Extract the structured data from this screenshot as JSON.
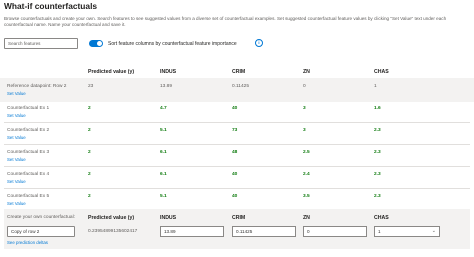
{
  "header": {
    "title": "What-if counterfactuals",
    "description": "Browse counterfactuals and create your own. Search features to see suggested values from a diverse set of counterfactual examples. Set suggested counterfactual feature values by clicking \"Set Value\" text under each counterfactual name. Name your counterfactual and save it."
  },
  "controls": {
    "search_placeholder": "Search features",
    "toggle_label": "Sort feature columns by counterfactual feature importance",
    "toggle_on": true,
    "info_glyph": "i"
  },
  "table": {
    "columns": [
      "",
      "Predicted value (y)",
      "INDUS",
      "CRIM",
      "ZN",
      "CHAS"
    ],
    "set_value_label": "Set Value",
    "reference": {
      "name": "Reference datapoint: Row 2",
      "values": [
        "23",
        "13.89",
        "0.11425",
        "0",
        "1"
      ]
    },
    "rows": [
      {
        "name": "Counterfactual Ex 1",
        "values": [
          "2",
          "4.7",
          "40",
          "3",
          "1.6"
        ]
      },
      {
        "name": "Counterfactual Ex 2",
        "values": [
          "2",
          "5.1",
          "73",
          "3",
          "2.3"
        ]
      },
      {
        "name": "Counterfactual Ex 3",
        "values": [
          "2",
          "6.1",
          "48",
          "2.5",
          "2.3"
        ]
      },
      {
        "name": "Counterfactual Ex 4",
        "values": [
          "2",
          "6.1",
          "40",
          "2.4",
          "2.3"
        ]
      },
      {
        "name": "Counterfactual Ex 5",
        "values": [
          "2",
          "5.1",
          "40",
          "3.5",
          "2.3"
        ]
      }
    ]
  },
  "create": {
    "label": "Create your own counterfactual:",
    "name_value": "Copy of row 2",
    "prediction_header": "Predicted value (y)",
    "prediction_value": "0.23954899135602417",
    "deltas_link": "See prediction deltas",
    "headers": [
      "INDUS",
      "CRIM",
      "ZN",
      "CHAS"
    ],
    "inputs": [
      "13.89",
      "0.11425",
      "0",
      "1"
    ]
  },
  "colors": {
    "accent": "#0078d4",
    "changed_value": "#107c10"
  }
}
